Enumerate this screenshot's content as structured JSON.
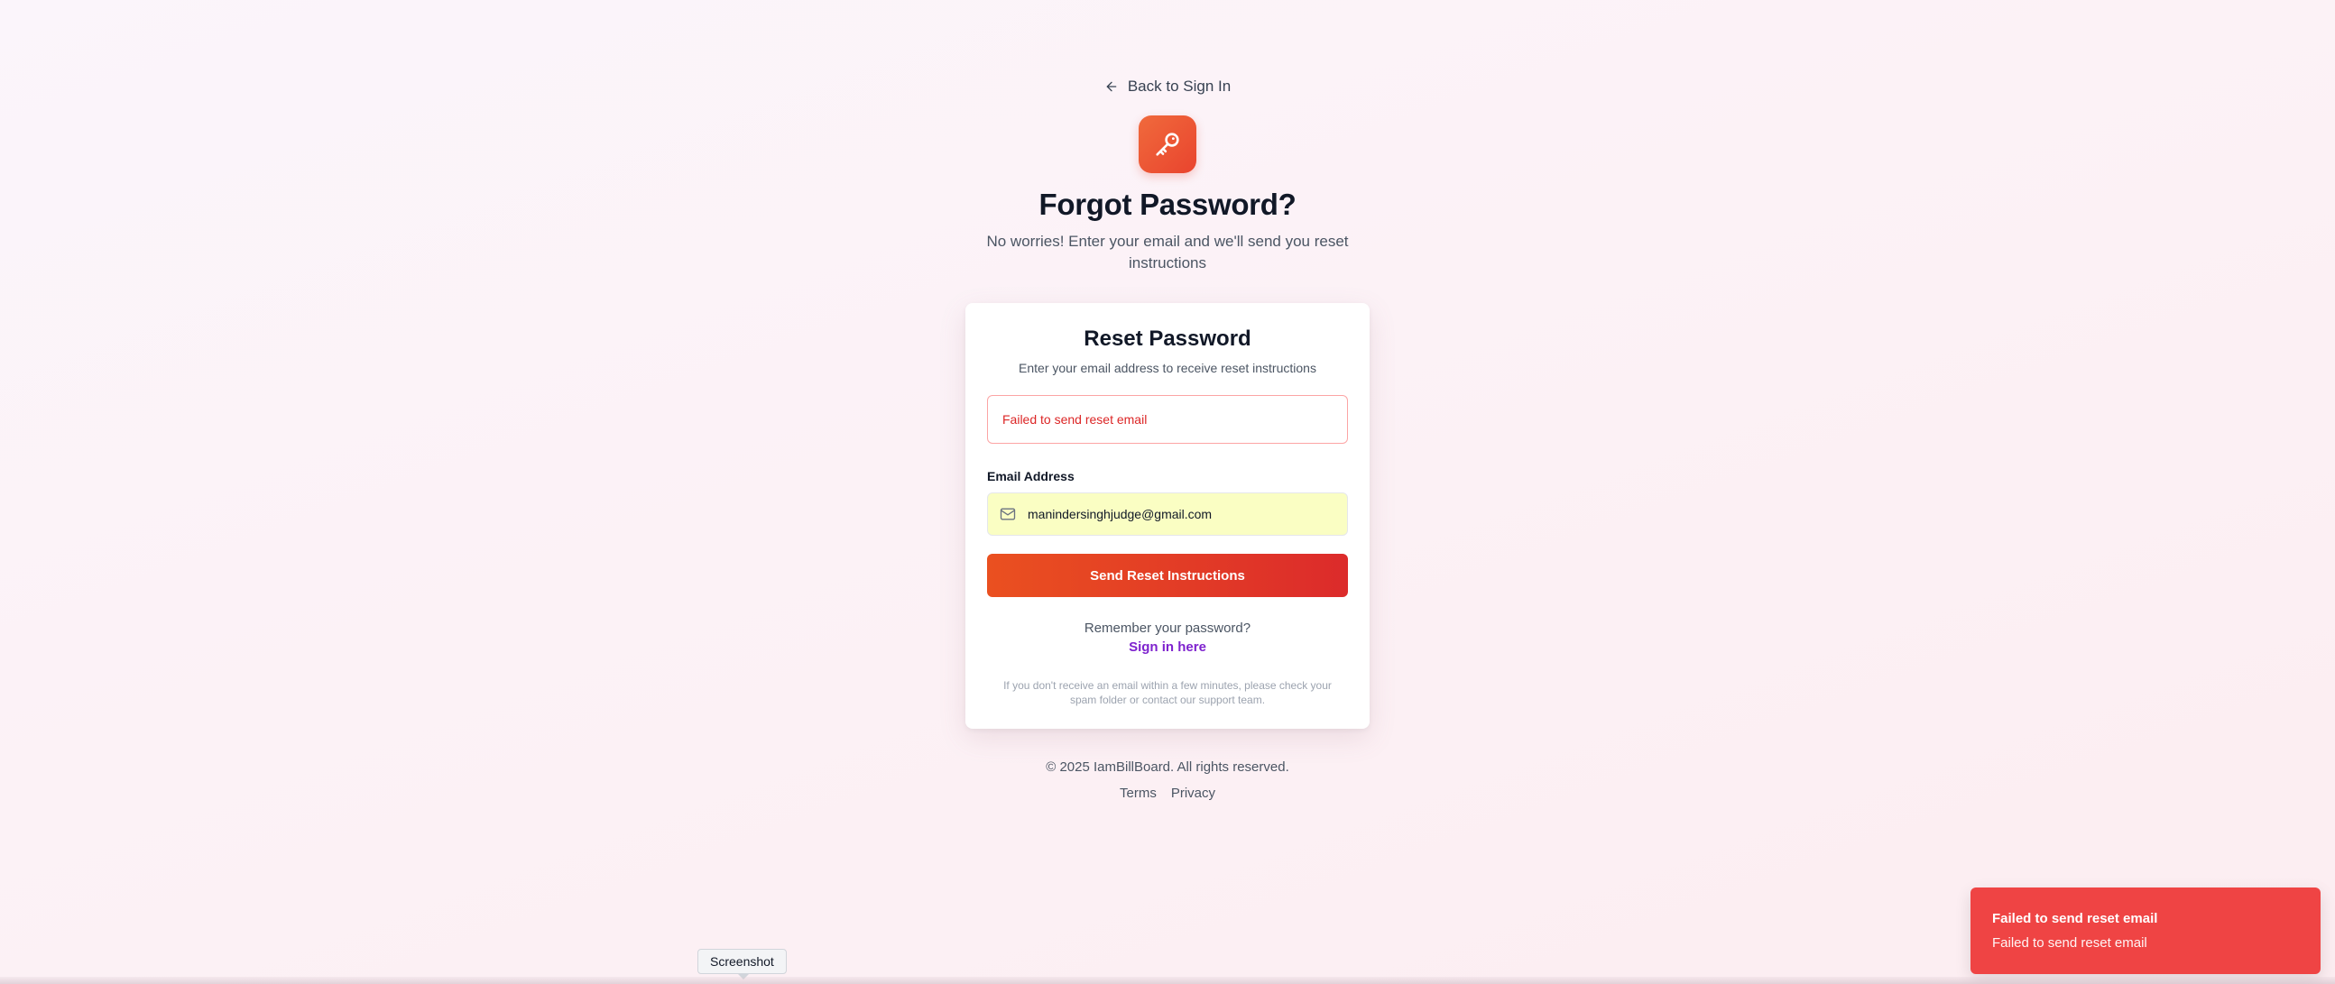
{
  "nav": {
    "back_label": "Back to Sign In"
  },
  "header": {
    "title": "Forgot Password?",
    "subtitle": "No worries! Enter your email and we'll send you reset instructions"
  },
  "card": {
    "title": "Reset Password",
    "description": "Enter your email address to receive reset instructions",
    "error_message": "Failed to send reset email",
    "email_label": "Email Address",
    "email_value": "manindersinghjudge@gmail.com",
    "submit_label": "Send Reset Instructions",
    "remember_text": "Remember your password?",
    "signin_link": "Sign in here",
    "help_text": "If you don't receive an email within a few minutes, please check your spam folder or contact our support team."
  },
  "footer": {
    "copyright": "© 2025 IamBillBoard. All rights reserved.",
    "links": [
      "Terms",
      "Privacy"
    ]
  },
  "toast": {
    "title": "Failed to send reset email",
    "description": "Failed to send reset email"
  },
  "tooltip": {
    "label": "Screenshot"
  },
  "colors": {
    "accent": "#e9442e",
    "button_start": "#ea5020",
    "button_end": "#dc2b2b",
    "link": "#7e22ce",
    "error": "#dc2626",
    "toast_bg": "#ef4444",
    "input_bg": "#fafec3"
  },
  "icons": {
    "back": "arrow-left-icon",
    "logo": "key-icon",
    "email": "mail-icon"
  }
}
